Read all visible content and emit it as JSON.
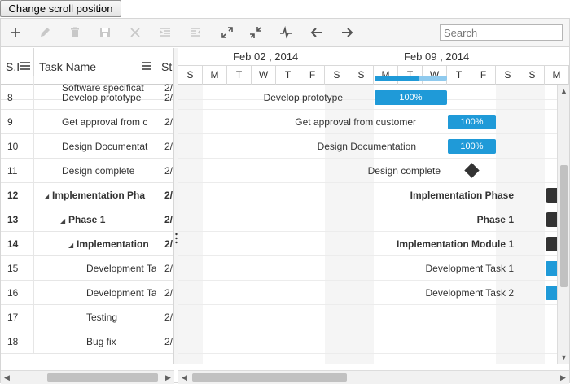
{
  "top_button": {
    "label": "Change scroll position"
  },
  "toolbar": {
    "search_placeholder": "Search",
    "icons": [
      "add-icon",
      "edit-icon",
      "delete-icon",
      "save-icon",
      "cancel-icon",
      "indent-icon",
      "outdent-icon",
      "expand-all-icon",
      "collapse-all-icon",
      "critical-path-icon",
      "prev-timespan-icon",
      "next-timespan-icon"
    ]
  },
  "grid": {
    "headers": {
      "id": "S.I",
      "name": "Task Name",
      "start": "St"
    },
    "partial_row": {
      "id": "",
      "name": "Software specificat",
      "start": "2/"
    },
    "rows": [
      {
        "id": "8",
        "name": "Develop prototype",
        "start": "2/",
        "level": 0,
        "bold": false,
        "expander": ""
      },
      {
        "id": "9",
        "name": "Get approval from c",
        "start": "2/",
        "level": 0,
        "bold": false,
        "expander": ""
      },
      {
        "id": "10",
        "name": "Design Documentat",
        "start": "2/",
        "level": 0,
        "bold": false,
        "expander": ""
      },
      {
        "id": "11",
        "name": "Design complete",
        "start": "2/",
        "level": 0,
        "bold": false,
        "expander": ""
      },
      {
        "id": "12",
        "name": "Implementation Pha",
        "start": "2/",
        "level": 0,
        "bold": true,
        "expander": "◢"
      },
      {
        "id": "13",
        "name": "Phase 1",
        "start": "2/",
        "level": 1,
        "bold": true,
        "expander": "◢"
      },
      {
        "id": "14",
        "name": "Implementation",
        "start": "2/",
        "level": 2,
        "bold": true,
        "expander": "◢"
      },
      {
        "id": "15",
        "name": "Development Ta",
        "start": "2/",
        "level": 3,
        "bold": false,
        "expander": ""
      },
      {
        "id": "16",
        "name": "Development Ta",
        "start": "2/",
        "level": 3,
        "bold": false,
        "expander": ""
      },
      {
        "id": "17",
        "name": "Testing",
        "start": "2/",
        "level": 3,
        "bold": false,
        "expander": ""
      },
      {
        "id": "18",
        "name": "Bug fix",
        "start": "2/",
        "level": 3,
        "bold": false,
        "expander": ""
      }
    ]
  },
  "timeline": {
    "weeks": [
      "Feb 02 , 2014",
      "Feb 09 , 2014"
    ],
    "days": [
      "S",
      "M",
      "T",
      "W",
      "T",
      "F",
      "S",
      "S",
      "M",
      "T",
      "W",
      "T",
      "F",
      "S",
      "S",
      "M"
    ]
  },
  "chart_rows": [
    {
      "label": "Develop prototype",
      "bar_text": "100%"
    },
    {
      "label": "Get approval from customer",
      "bar_text": "100%"
    },
    {
      "label": "Design Documentation",
      "bar_text": "100%"
    },
    {
      "label": "Design complete",
      "bar_text": ""
    },
    {
      "label": "Implementation Phase",
      "bar_text": ""
    },
    {
      "label": "Phase 1",
      "bar_text": ""
    },
    {
      "label": "Implementation Module 1",
      "bar_text": ""
    },
    {
      "label": "Development Task 1",
      "bar_text": ""
    },
    {
      "label": "Development Task 2",
      "bar_text": ""
    }
  ],
  "scroll_arrows": {
    "left": "◀",
    "right": "▶",
    "up": "▲",
    "down": "▼"
  }
}
